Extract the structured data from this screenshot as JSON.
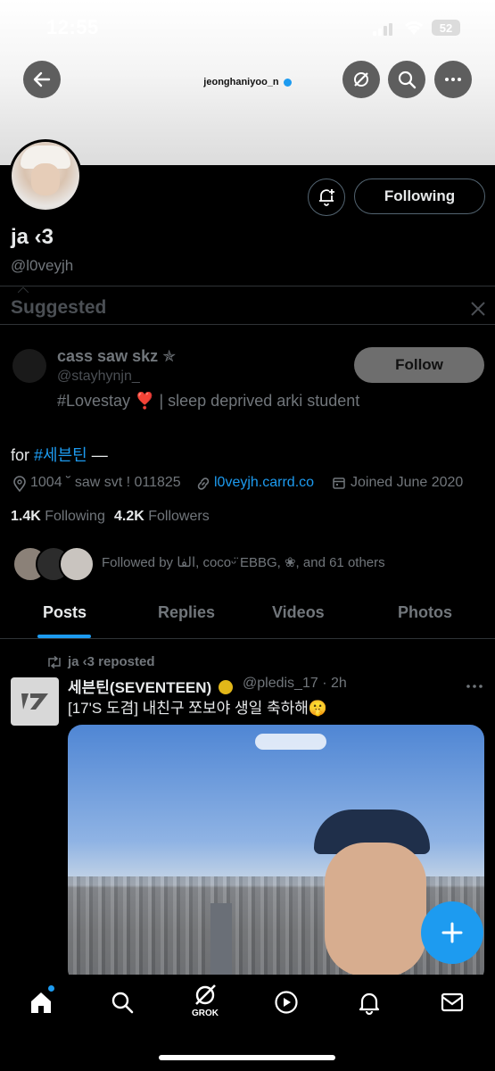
{
  "status_bar": {
    "time": "12:55",
    "battery": "52"
  },
  "header": {
    "handle": "jeonghaniyoo_n"
  },
  "profile": {
    "follow_state_label": "Following",
    "name": "ja ‹3",
    "username": "@l0veyjh",
    "bio": "for ",
    "bio_hashtag": "#세븐틴",
    "bio_end": " —",
    "location": "1004 ˘ saw svt ! 011825",
    "link": "l0veyjh.carrd.co",
    "joined": "Joined June 2020",
    "following_count": "1.4K",
    "following_label": "Following",
    "followers_count": "4.2K",
    "followers_label": "Followers",
    "followed_by": "Followed by الفا, cocoᵕ̈ EBBG, ❀, and 61 others"
  },
  "suggested": {
    "title": "Suggested",
    "user_name": "cass saw skz ✯",
    "user_handle": "@stayhynjn_",
    "user_bio": "#Lovestay ❣️ | sleep deprived arki student",
    "follow_label": "Follow"
  },
  "tabs": [
    {
      "label": "Posts",
      "active": true
    },
    {
      "label": "Replies",
      "active": false
    },
    {
      "label": "Videos",
      "active": false
    },
    {
      "label": "Photos",
      "active": false
    }
  ],
  "post": {
    "repost_text": "ja ‹3 reposted",
    "author": "세븐틴(SEVENTEEN)",
    "handle_time": "@pledis_17 · 2h",
    "text": "[17'S 도겸] 내친구 쪼보야 생일 축하해🤫"
  },
  "bottom_nav": {
    "grok_label": "GROK"
  },
  "colors": {
    "accent": "#1d9bf0",
    "muted": "#71767b",
    "follow_bg": "#d6d9db"
  }
}
